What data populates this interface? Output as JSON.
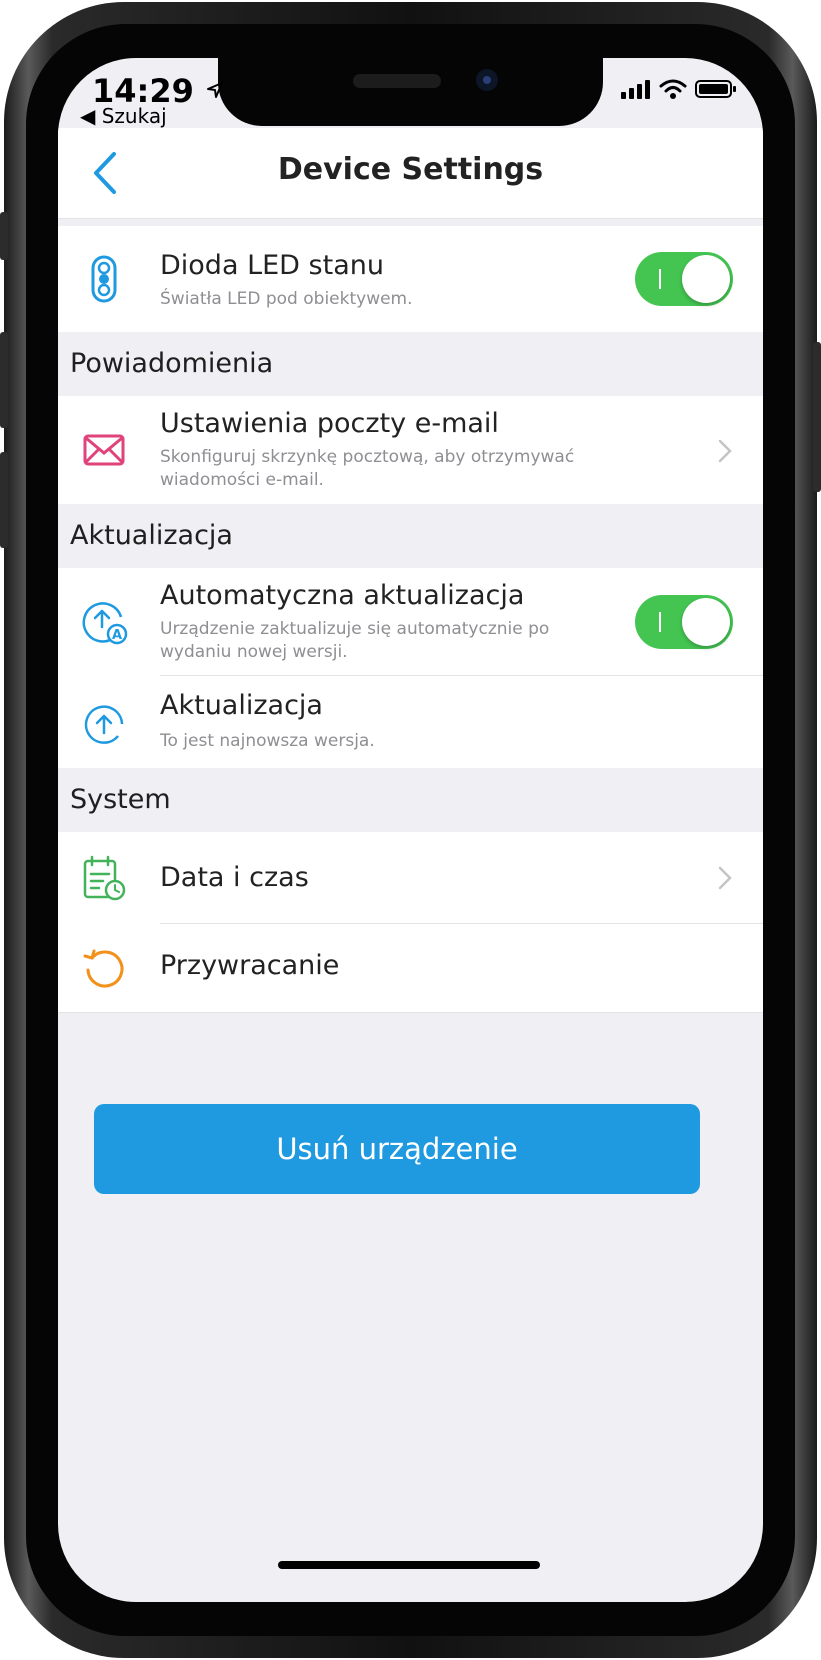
{
  "status_bar": {
    "time": "14:29",
    "back_app": "◀ Szukaj"
  },
  "nav": {
    "title": "Device Settings",
    "back_icon": "chevron-left-icon"
  },
  "rows": {
    "led": {
      "title": "Dioda LED stanu",
      "subtitle": "Światła LED pod obiektywem.",
      "toggle_on": true,
      "icon": "traffic-light-icon"
    },
    "email": {
      "title": "Ustawienia poczty e-mail",
      "subtitle": "Skonfiguruj skrzynkę pocztową, aby otrzymywać wiadomości e-mail.",
      "icon": "mail-icon"
    },
    "auto_update": {
      "title": "Automatyczna aktualizacja",
      "subtitle": "Urządzenie zaktualizuje się automatycznie po wydaniu nowej wersji.",
      "toggle_on": true,
      "icon": "auto-update-icon"
    },
    "update": {
      "title": "Aktualizacja",
      "subtitle": "To jest najnowsza wersja.",
      "icon": "upload-arrow-icon"
    },
    "datetime": {
      "title": "Data i czas",
      "icon": "calendar-clock-icon"
    },
    "restore": {
      "title": "Przywracanie",
      "icon": "restore-icon"
    }
  },
  "sections": {
    "notifications": "Powiadomienia",
    "update": "Aktualizacja",
    "system": "System"
  },
  "delete_button": "Usuń urządzenie",
  "colors": {
    "accent_blue": "#1f9ae0",
    "toggle_green": "#44c552",
    "mail_pink": "#e0427a",
    "restore_orange": "#f2911c",
    "calendar_green": "#43b35a"
  }
}
